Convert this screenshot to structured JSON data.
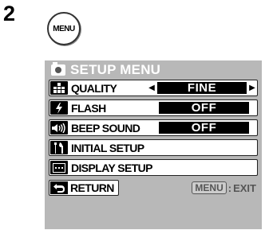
{
  "step": {
    "number": "2"
  },
  "menu_button": {
    "label": "MENU"
  },
  "panel": {
    "title": "SETUP MENU",
    "title_icon": "camera-icon",
    "rows": [
      {
        "label": "QUALITY",
        "icon": "quality-grid-icon",
        "value": "FINE",
        "has_arrows": true
      },
      {
        "label": "FLASH",
        "icon": "flash-icon",
        "value": "OFF"
      },
      {
        "label": "BEEP SOUND",
        "icon": "speaker-icon",
        "value": "OFF"
      },
      {
        "label": "INITIAL SETUP",
        "icon": "tools-icon"
      },
      {
        "label": "DISPLAY SETUP",
        "icon": "display-icon"
      }
    ],
    "return_label": "RETURN",
    "exit_key": "MENU",
    "exit_label": "EXIT",
    "exit_separator": ":"
  },
  "colors": {
    "panel_bg": "#b8b8b8",
    "row_bg": "#ffffff",
    "value_bg": "#000000",
    "value_text": "#ffffff"
  }
}
